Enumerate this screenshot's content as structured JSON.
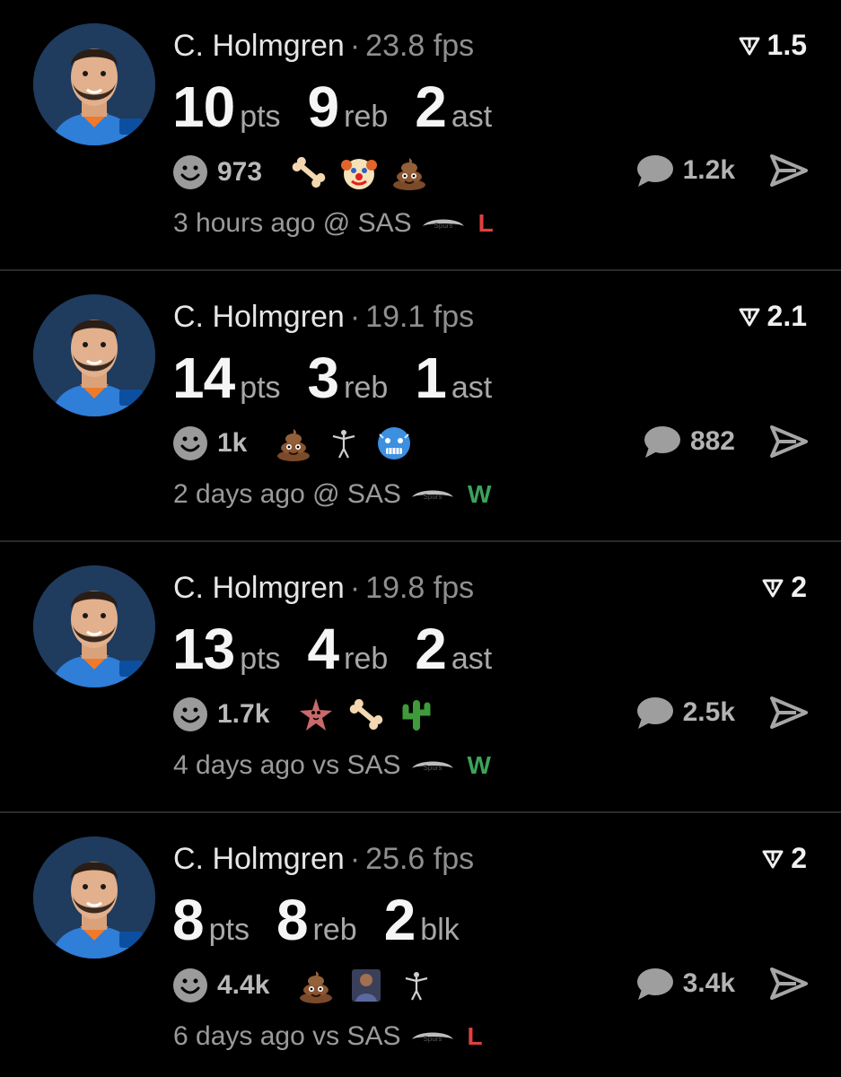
{
  "posts": [
    {
      "name": "C. Holmgren",
      "separator": "·",
      "fps": "23.8 fps",
      "rating": "1.5",
      "stats": [
        {
          "num": "10",
          "unit": "pts"
        },
        {
          "num": "9",
          "unit": "reb"
        },
        {
          "num": "2",
          "unit": "ast"
        }
      ],
      "reaction_count": "973",
      "emojis": [
        "bone-emoji",
        "clown-emoji",
        "poop-emoji"
      ],
      "comment_count": "1.2k",
      "time": "3 hours ago",
      "venue": "@ SAS",
      "result": "L"
    },
    {
      "name": "C. Holmgren",
      "separator": "·",
      "fps": "19.1 fps",
      "rating": "2.1",
      "stats": [
        {
          "num": "14",
          "unit": "pts"
        },
        {
          "num": "3",
          "unit": "reb"
        },
        {
          "num": "1",
          "unit": "ast"
        }
      ],
      "reaction_count": "1k",
      "emojis": [
        "poop-emoji",
        "player-figure-emoji",
        "cold-face-emoji"
      ],
      "comment_count": "882",
      "time": "2 days ago",
      "venue": "@ SAS",
      "result": "W"
    },
    {
      "name": "C. Holmgren",
      "separator": "·",
      "fps": "19.8 fps",
      "rating": "2",
      "stats": [
        {
          "num": "13",
          "unit": "pts"
        },
        {
          "num": "4",
          "unit": "reb"
        },
        {
          "num": "2",
          "unit": "ast"
        }
      ],
      "reaction_count": "1.7k",
      "emojis": [
        "starfish-emoji",
        "bone-emoji",
        "cactus-emoji"
      ],
      "comment_count": "2.5k",
      "time": "4 days ago",
      "venue": "vs SAS",
      "result": "W"
    },
    {
      "name": "C. Holmgren",
      "separator": "·",
      "fps": "25.6 fps",
      "rating": "2",
      "stats": [
        {
          "num": "8",
          "unit": "pts"
        },
        {
          "num": "8",
          "unit": "reb"
        },
        {
          "num": "2",
          "unit": "blk"
        }
      ],
      "reaction_count": "4.4k",
      "emojis": [
        "poop-emoji",
        "player-photo-emoji",
        "player-figure-emoji"
      ],
      "comment_count": "3.4k",
      "time": "6 days ago",
      "venue": "vs SAS",
      "result": "L"
    }
  ],
  "colors": {
    "background": "#000000",
    "loss": "#e04040",
    "win": "#3aa35a"
  }
}
